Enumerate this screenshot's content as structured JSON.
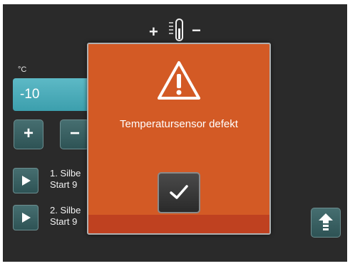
{
  "temperature_indicator": {
    "plus": "+",
    "minus": "−",
    "icon": "thermometer-icon"
  },
  "setpoint": {
    "unit": "°C",
    "value": "-10",
    "plus_label": "+",
    "minus_label": "−"
  },
  "programs": [
    {
      "line1": "1. Silbe",
      "line2": "Start 9",
      "icon": "play-icon"
    },
    {
      "line1": "2. Silbe",
      "line2": "Start 9",
      "icon": "play-icon"
    }
  ],
  "up_button": {
    "icon": "arrow-up-icon"
  },
  "modal": {
    "icon": "warning-icon",
    "message": "Temperatursensor defekt",
    "confirm_icon": "checkmark-icon"
  },
  "colors": {
    "background": "#2a2a2a",
    "modal": "#d35a25",
    "display": "#4aa9b6",
    "button": "#3a6163"
  }
}
